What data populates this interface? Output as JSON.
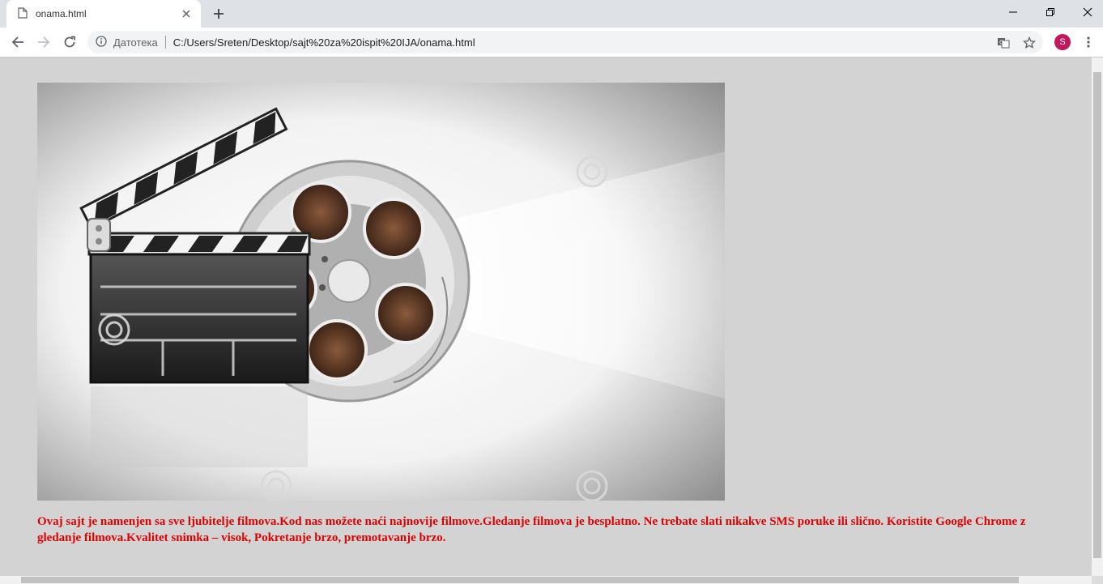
{
  "browser": {
    "tab_title": "onama.html",
    "security_label": "Датотека",
    "url": "C:/Users/Sreten/Desktop/sajt%20za%20ispit%20IJA/onama.html",
    "profile_initial": "S",
    "profile_color": "#c2185b"
  },
  "page": {
    "hero_image": {
      "description_icon": "film-clapperboard-and-reel",
      "watermark": "dreamstime"
    },
    "intro_line_1": "Ovaj sajt je namenjen sa sve ljubitelje filmova.Kod nas možete naći najnovije filmove.Gledanje filmova je besplatno. Ne trebate slati nikakve SMS poruke ili slično. Koristite Google Chrome z",
    "intro_line_2": "gledanje filmova.Kvalitet snimka – visok, Pokretanje brzo, premotavanje brzo.",
    "text_color": "#e00000",
    "background_color": "#d3d3d3"
  }
}
